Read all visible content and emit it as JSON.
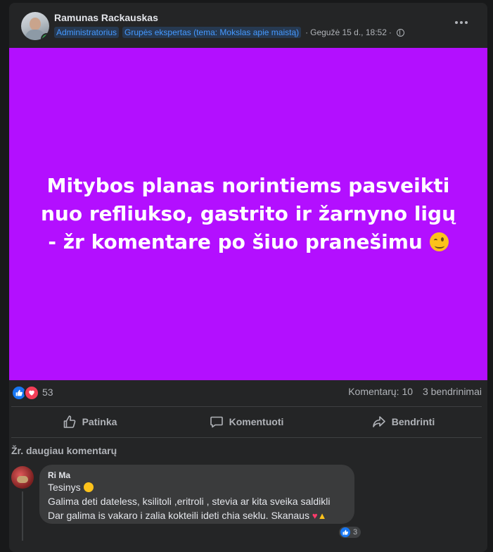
{
  "post": {
    "author": "Ramunas Rackauskas",
    "badges": [
      "Administratorius",
      "Grupės ekspertas (tema: Mokslas apie maistą)"
    ],
    "date": "Gegužė 15 d., 18:52",
    "separator": "·",
    "image_text": "Mitybos planas norintiems pasveikti nuo refliukso, gastrito ir žarnyno ligų - žr komentare po šiuo pranešimu",
    "image_bg": "#b30fff"
  },
  "stats": {
    "reactions_count": "53",
    "comments": "Komentarų: 10",
    "shares": "3 bendrinimai"
  },
  "actions": {
    "like": "Patinka",
    "comment": "Komentuoti",
    "share": "Bendrinti"
  },
  "comments": {
    "more_label": "Žr. daugiau komentarų",
    "items": [
      {
        "author": "Ri Ma",
        "line1": "Tesinys",
        "line2": "Galima deti dateless, ksilitoli ,eritroli , stevia ar kita sveika saldikli",
        "line3": "Dar galima is vakaro i zalia kokteili ideti chia seklu. Skanaus",
        "reactions": "3"
      }
    ]
  },
  "colors": {
    "accent": "#4599ff",
    "like_blue": "#1877f2",
    "love_red": "#f33e58"
  }
}
